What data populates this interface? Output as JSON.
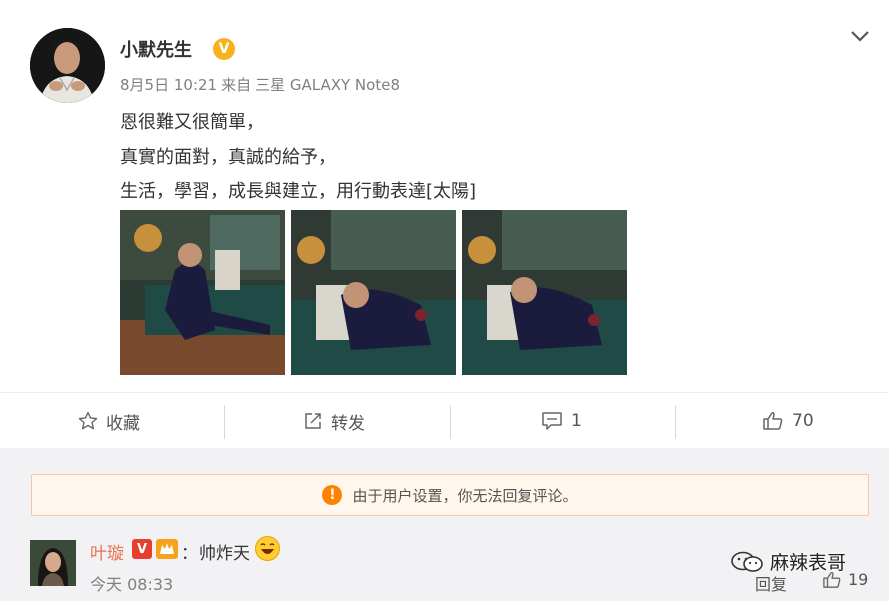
{
  "post": {
    "author": "小默先生",
    "verified_badge": "V",
    "date": "8月5日 10:21",
    "via": "来自",
    "device": "三星 GALAXY Note8",
    "lines": [
      "恩很難又很簡單，",
      "真實的面對，真誠的給予，",
      "生活，學習，成長與建立，用行動表達[太陽]"
    ],
    "photo_count": 3
  },
  "actions": {
    "favorite": "收藏",
    "repost": "转发",
    "comments": "1",
    "likes": "70"
  },
  "notice": {
    "icon": "!",
    "text": "由于用户设置，你无法回复评论。"
  },
  "comment": {
    "user": "叶璇",
    "badge_v": "V",
    "colon": "：",
    "text": "帅炸天",
    "time": "今天 08:33",
    "reply": "回复",
    "likes": "19"
  },
  "watermark": "麻辣表哥",
  "colors": {
    "accent_orange": "#ff8200",
    "link": "#eb7350",
    "verified": "#f7b21b"
  }
}
